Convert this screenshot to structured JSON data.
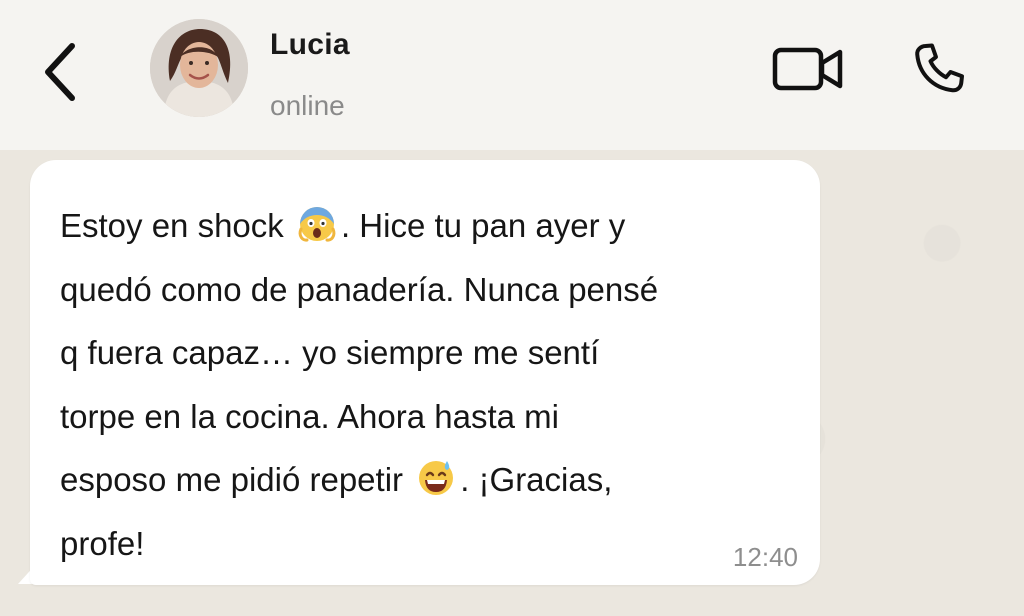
{
  "header": {
    "back_icon": "chevron-left-icon",
    "contact_name": "Lucia",
    "contact_status": "online",
    "video_icon": "video-camera-icon",
    "call_icon": "phone-icon"
  },
  "message": {
    "segments": [
      "Estoy en shock",
      ". Hice tu pan ayer y",
      "quedó como de panadería. Nunca pensé",
      "q fuera capaz… yo siempre me sentí",
      "torpe en la cocina. Ahora hasta mi",
      "esposo me pidió repetir",
      ". ¡Gracias,",
      "profe!"
    ],
    "emojis": [
      "face-screaming-in-fear-emoji",
      "grinning-face-with-sweat-emoji"
    ],
    "time": "12:40"
  },
  "colors": {
    "header_bg": "#f5f4f1",
    "chat_bg": "#ebe7df",
    "bubble_bg": "#ffffff",
    "text": "#161616",
    "muted": "#8a8a8a"
  }
}
